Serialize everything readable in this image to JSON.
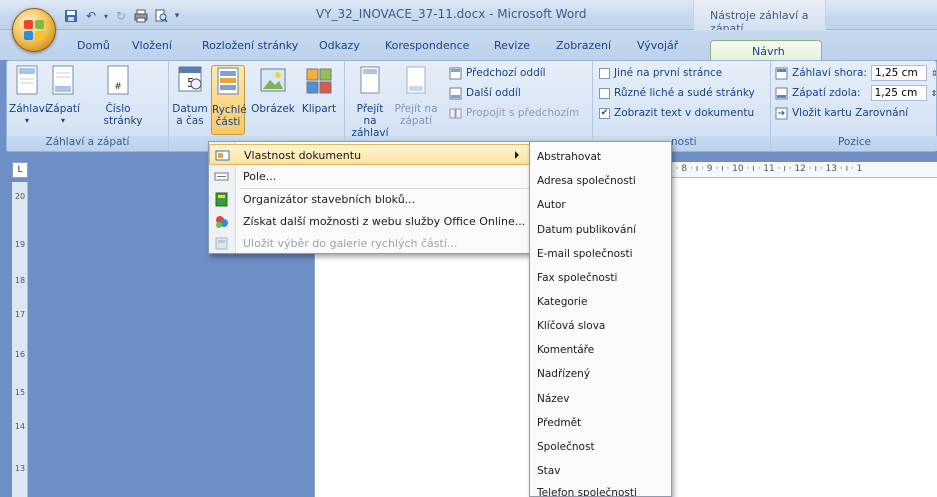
{
  "window": {
    "doc_title": "VY_32_INOVACE_37-11.docx - Microsoft Word",
    "context_title": "Nástroje záhlaví a zápatí"
  },
  "tabs": [
    "Domů",
    "Vložení",
    "Rozložení stránky",
    "Odkazy",
    "Korespondence",
    "Revize",
    "Zobrazení",
    "Vývojář"
  ],
  "active_tab": "Návrh",
  "ribbon": {
    "group1": {
      "buttons": {
        "header": "Záhlaví",
        "footer": "Zápatí",
        "page_number_1": "Číslo",
        "page_number_2": "stránky"
      },
      "label": "Záhlaví a zápatí"
    },
    "insert": {
      "date_1": "Datum",
      "date_2": "a čas",
      "quick_1": "Rychlé",
      "quick_2": "části",
      "picture": "Obrázek",
      "clipart": "Klipart"
    },
    "nav": {
      "goto_header_1": "Přejít na",
      "goto_header_2": "záhlaví",
      "goto_footer_1": "Přejít na",
      "goto_footer_2": "zápatí",
      "prev_section": "Předchozí oddíl",
      "next_section": "Další oddíl",
      "link_prev": "Propojit s předchozím"
    },
    "options": {
      "first_page": "Jiné na první stránce",
      "odd_even": "Různé liché a sudé stránky",
      "show_text": "Zobrazit text v dokumentu",
      "label_tail": "nosti"
    },
    "position": {
      "header_from_top": "Záhlaví shora:",
      "header_value": "1,25 cm",
      "footer_from_bottom": "Zápatí zdola:",
      "footer_value": "1,25 cm",
      "align_tab": "Vložit kartu Zarovnání",
      "label": "Pozice"
    }
  },
  "ruler": {
    "h_text": "7 · ı · 8 · ı · 9 · ı · 10 · ı · 11 · ı · 12 · ı · 13 · ı · 1",
    "v_ticks": [
      "20",
      "19",
      "18",
      "17",
      "16",
      "15",
      "14",
      "13"
    ],
    "corner": "L"
  },
  "menu": {
    "items": [
      {
        "label": "Vlastnost dokumentu",
        "state": "highlighted"
      },
      {
        "label": "Pole...",
        "state": "enabled"
      },
      {
        "label": "Organizátor stavebních bloků...",
        "state": "enabled"
      },
      {
        "label": "Získat další možnosti z webu služby Office Online...",
        "state": "enabled"
      },
      {
        "label": "Uložit výběr do galerie rychlých částí...",
        "state": "disabled"
      }
    ]
  },
  "submenu": {
    "items": [
      "Abstrahovat",
      "Adresa společnosti",
      "Autor",
      "Datum publikování",
      "E-mail společnosti",
      "Fax společnosti",
      "Kategorie",
      "Klíčová slova",
      "Komentáře",
      "Nadřízený",
      "Název",
      "Předmět",
      "Společnost",
      "Stav",
      "Telefon společnosti"
    ]
  },
  "colors": {
    "accent": "#15428b",
    "highlight": "#fde3a0",
    "context_green": "#b4d69a"
  }
}
